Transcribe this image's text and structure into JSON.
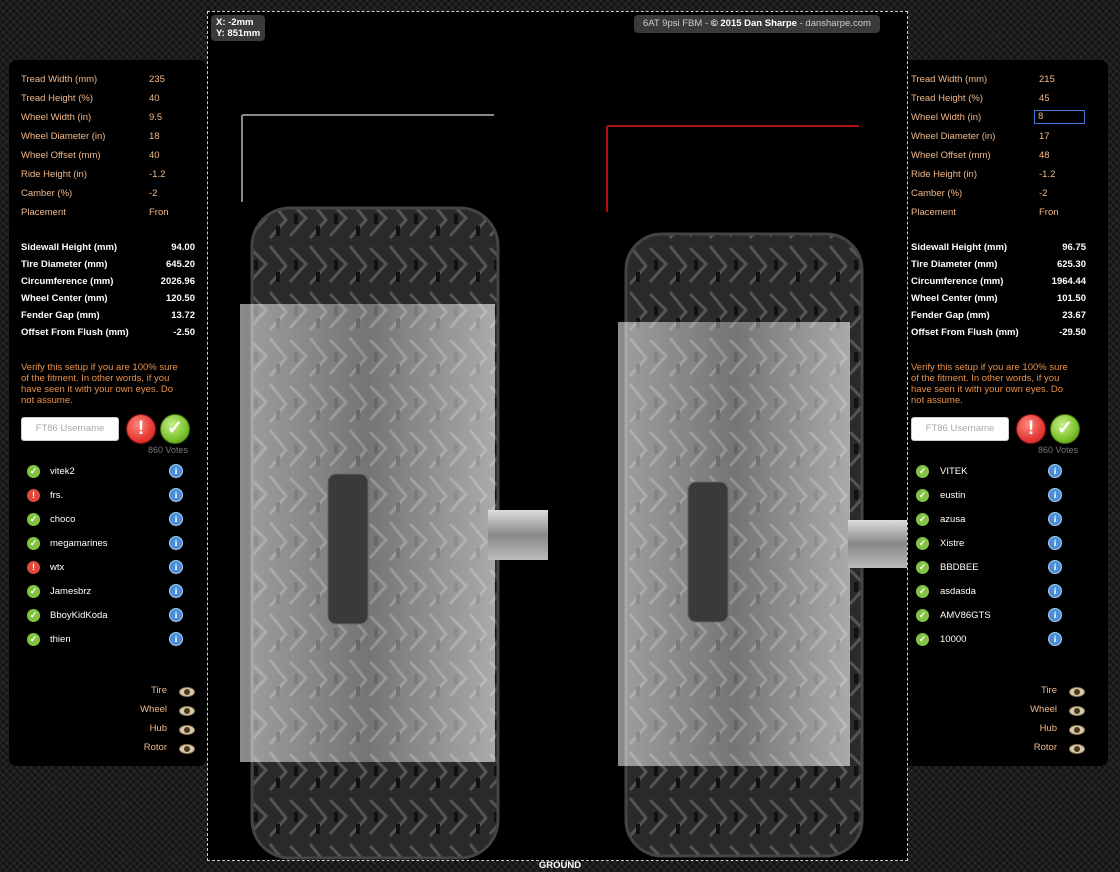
{
  "coords": {
    "x": "X: -2mm",
    "y": "Y: 851mm"
  },
  "credit": {
    "prefix": "6AT 9psi FBM - ",
    "copyright": "© 2015 Dan Sharpe",
    "suffix": " - dansharpe.com"
  },
  "ground_label": "GROUND",
  "left": {
    "inputs": [
      {
        "label": "Tread Width (mm)",
        "value": "235"
      },
      {
        "label": "Tread Height (%)",
        "value": "40"
      },
      {
        "label": "Wheel Width (in)",
        "value": "9.5"
      },
      {
        "label": "Wheel Diameter (in)",
        "value": "18"
      },
      {
        "label": "Wheel Offset (mm)",
        "value": "40"
      },
      {
        "label": "Ride Height (in)",
        "value": "-1.2"
      },
      {
        "label": "Camber (%)",
        "value": "-2"
      },
      {
        "label": "Placement",
        "value": "Fron"
      }
    ],
    "stats": [
      {
        "label": "Sidewall Height (mm)",
        "value": "94.00"
      },
      {
        "label": "Tire Diameter (mm)",
        "value": "645.20"
      },
      {
        "label": "Circumference (mm)",
        "value": "2026.96"
      },
      {
        "label": "Wheel Center (mm)",
        "value": "120.50"
      },
      {
        "label": "Fender Gap (mm)",
        "value": "13.72"
      },
      {
        "label": "Offset From Flush (mm)",
        "value": "-2.50"
      }
    ],
    "verify_lines": [
      "Verify this setup if you are 100% sure",
      "of the fitment. In other words, if you",
      "have seen it with your own eyes. Do",
      "not assume."
    ],
    "username_placeholder": "FT86 Username",
    "votes": "860 Votes",
    "users": [
      {
        "name": "vitek2",
        "status": "ok"
      },
      {
        "name": "frs.",
        "status": "bad"
      },
      {
        "name": "choco",
        "status": "ok"
      },
      {
        "name": "megamarines",
        "status": "ok"
      },
      {
        "name": "wtx",
        "status": "bad"
      },
      {
        "name": "Jamesbrz",
        "status": "ok"
      },
      {
        "name": "BboyKidKoda",
        "status": "ok"
      },
      {
        "name": "thien",
        "status": "ok"
      }
    ],
    "layers": [
      "Tire",
      "Wheel",
      "Hub",
      "Rotor"
    ]
  },
  "right": {
    "inputs": [
      {
        "label": "Tread Width (mm)",
        "value": "215"
      },
      {
        "label": "Tread Height (%)",
        "value": "45"
      },
      {
        "label": "Wheel Width (in)",
        "value": "8"
      },
      {
        "label": "Wheel Diameter (in)",
        "value": "17"
      },
      {
        "label": "Wheel Offset (mm)",
        "value": "48"
      },
      {
        "label": "Ride Height (in)",
        "value": "-1.2"
      },
      {
        "label": "Camber (%)",
        "value": "-2"
      },
      {
        "label": "Placement",
        "value": "Fron"
      }
    ],
    "stats": [
      {
        "label": "Sidewall Height (mm)",
        "value": "96.75"
      },
      {
        "label": "Tire Diameter (mm)",
        "value": "625.30"
      },
      {
        "label": "Circumference (mm)",
        "value": "1964.44"
      },
      {
        "label": "Wheel Center (mm)",
        "value": "101.50"
      },
      {
        "label": "Fender Gap (mm)",
        "value": "23.67"
      },
      {
        "label": "Offset From Flush (mm)",
        "value": "-29.50"
      }
    ],
    "verify_lines": [
      "Verify this setup if you are 100% sure",
      "of the fitment. In other words, if you",
      "have seen it with your own eyes. Do",
      "not assume."
    ],
    "username_placeholder": "FT86 Username",
    "votes": "860 Votes",
    "users": [
      {
        "name": "VITEK",
        "status": "ok"
      },
      {
        "name": "eustin",
        "status": "ok"
      },
      {
        "name": "azusa",
        "status": "ok"
      },
      {
        "name": "Xistre",
        "status": "ok"
      },
      {
        "name": "BBDBEE",
        "status": "ok"
      },
      {
        "name": "asdasda",
        "status": "ok"
      },
      {
        "name": "AMV86GTS",
        "status": "ok"
      },
      {
        "name": "10000",
        "status": "ok"
      }
    ],
    "layers": [
      "Tire",
      "Wheel",
      "Hub",
      "Rotor"
    ]
  },
  "colors": {
    "accent_orange": "#f0b889",
    "verify_orange": "#e8914a",
    "left_fender_line": "#888888",
    "right_fender_line": "#b01010",
    "info_blue": "#4a8fd6",
    "ok_green": "#82c341",
    "bad_red": "#e04a3a"
  }
}
